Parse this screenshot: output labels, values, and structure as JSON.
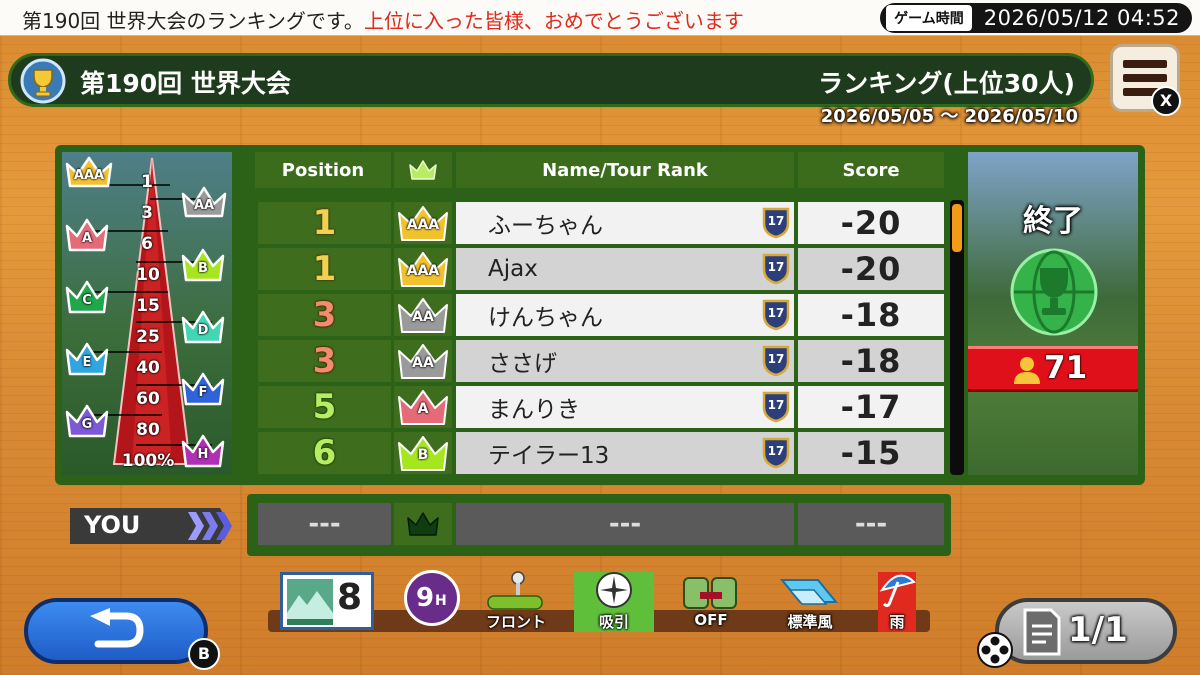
{
  "ticker": {
    "text_normal": "第190回 世界大会のランキングです。",
    "text_highlight": "上位に入った皆様、おめでとうございます",
    "clock_label": "ゲーム時間",
    "clock_value": "2026/05/12 04:52"
  },
  "header": {
    "event_title": "第190回 世界大会",
    "ranking_label": "ランキング(上位30人)",
    "date_range": "2026/05/05 ～ 2026/05/10",
    "close_key": "X"
  },
  "pyramid": {
    "tiers": [
      "AAA",
      "AA",
      "A",
      "B",
      "C",
      "D",
      "E",
      "F",
      "G",
      "H"
    ],
    "percentiles": [
      "1",
      "3",
      "6",
      "10",
      "15",
      "25",
      "40",
      "60",
      "80",
      "100%"
    ]
  },
  "table": {
    "headers": {
      "position": "Position",
      "name": "Name/Tour Rank",
      "score": "Score"
    },
    "rows": [
      {
        "position": "1",
        "rank": "AAA",
        "name": "ふーちゃん",
        "tour_rank": "17",
        "score": "-20"
      },
      {
        "position": "1",
        "rank": "AAA",
        "name": "Ajax",
        "tour_rank": "17",
        "score": "-20"
      },
      {
        "position": "3",
        "rank": "AA",
        "name": "けんちゃん",
        "tour_rank": "17",
        "score": "-18"
      },
      {
        "position": "3",
        "rank": "AA",
        "name": "ささげ",
        "tour_rank": "17",
        "score": "-18"
      },
      {
        "position": "5",
        "rank": "A",
        "name": "まんりき",
        "tour_rank": "17",
        "score": "-17"
      },
      {
        "position": "6",
        "rank": "B",
        "name": "テイラー13",
        "tour_rank": "17",
        "score": "-15"
      }
    ],
    "scroll_fraction_visible": 0.18
  },
  "you_row": {
    "tag": "YOU",
    "position": "---",
    "name": "---",
    "score": "---"
  },
  "course": {
    "status": "終了",
    "players": "71"
  },
  "status_bar": {
    "course_number": "8",
    "holes": "9",
    "holes_suffix": "H",
    "tee": "フロント",
    "green": "吸引",
    "assist": "OFF",
    "wind": "標準風",
    "weather": "雨"
  },
  "footer": {
    "back_key": "B",
    "page": "1/1"
  },
  "colors": {
    "panel_green": "#2c6217",
    "highlight_red": "#e02a1f",
    "position_gold": "#f0d250",
    "position_salmon": "#f48b6e",
    "position_green": "#b8ec62",
    "tier_AAA": "#f2c12e",
    "tier_AA": "#9a9a9a",
    "tier_A": "#e66b78",
    "tier_B": "#a6e61e",
    "tier_C": "#1fa84a",
    "tier_D": "#43d6b4",
    "tier_E": "#2fa6e0",
    "tier_F": "#2f63d9",
    "tier_G": "#7c5ad6",
    "tier_H": "#b02fb4"
  }
}
